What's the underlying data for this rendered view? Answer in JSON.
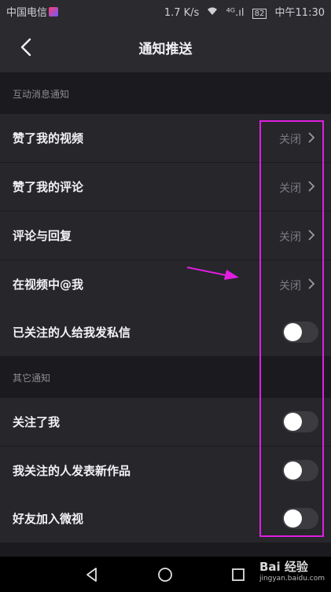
{
  "status_bar": {
    "carrier": "中国电信",
    "net_speed": "1.7 K/s",
    "signal": "⁴ᴳ.ıl",
    "battery": "82",
    "time": "中午11:30"
  },
  "header": {
    "title": "通知推送"
  },
  "sections": [
    {
      "label": "互动消息通知",
      "rows": [
        {
          "label": "赞了我的视频",
          "value": "关闭",
          "type": "select"
        },
        {
          "label": "赞了我的评论",
          "value": "关闭",
          "type": "select"
        },
        {
          "label": "评论与回复",
          "value": "关闭",
          "type": "select"
        },
        {
          "label": "在视频中@我",
          "value": "关闭",
          "type": "select"
        },
        {
          "label": "已关注的人给我发私信",
          "type": "toggle",
          "on": false
        }
      ]
    },
    {
      "label": "其它通知",
      "rows": [
        {
          "label": "关注了我",
          "type": "toggle",
          "on": false
        },
        {
          "label": "我关注的人发表新作品",
          "type": "toggle",
          "on": false
        },
        {
          "label": "好友加入微视",
          "type": "toggle",
          "on": false
        }
      ]
    }
  ],
  "annotation": {
    "color": "#e11ee0"
  },
  "watermark": {
    "brand": "Bai 经验",
    "url": "jingyan.baidu.com"
  }
}
